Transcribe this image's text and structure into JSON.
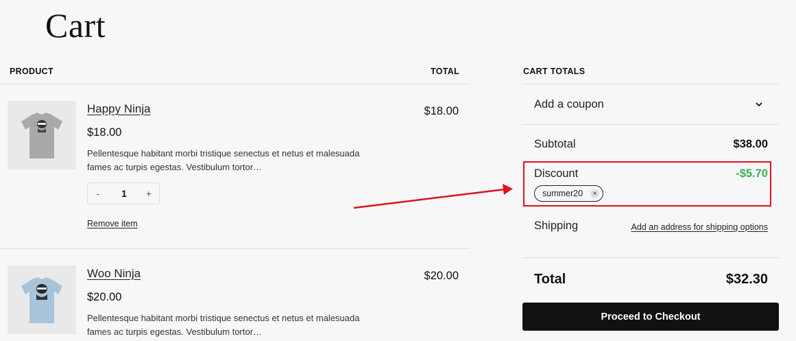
{
  "page": {
    "title": "Cart"
  },
  "table": {
    "col_product": "PRODUCT",
    "col_total": "TOTAL"
  },
  "items": [
    {
      "name": "Happy Ninja",
      "price": "$18.00",
      "description": "Pellentesque habitant morbi tristique senectus et netus et malesuada fames ac turpis egestas. Vestibulum tortor…",
      "line_total": "$18.00",
      "quantity": "1",
      "shirt_color": "#a9a9a9",
      "thumbnail_icon": "tshirt-ninja-gray"
    },
    {
      "name": "Woo Ninja",
      "price": "$20.00",
      "description": "Pellentesque habitant morbi tristique senectus et netus et malesuada fames ac turpis egestas. Vestibulum tortor…",
      "line_total": "$20.00",
      "shirt_color": "#a8c4da",
      "thumbnail_icon": "tshirt-ninja-blue"
    }
  ],
  "quantity_controls": {
    "minus": "-",
    "plus": "+"
  },
  "remove_label": "Remove item",
  "totals": {
    "heading": "CART TOTALS",
    "coupon_label": "Add a coupon",
    "subtotal_label": "Subtotal",
    "subtotal_value": "$38.00",
    "discount_label": "Discount",
    "discount_value": "-$5.70",
    "coupon_code": "summer20",
    "coupon_remove_glyph": "×",
    "shipping_label": "Shipping",
    "shipping_link": "Add an address for shipping options",
    "total_label": "Total",
    "total_value": "$32.30",
    "checkout_label": "Proceed to Checkout"
  },
  "colors": {
    "discount": "#3fae53",
    "highlight": "#e0121b",
    "button_bg": "#111111"
  }
}
